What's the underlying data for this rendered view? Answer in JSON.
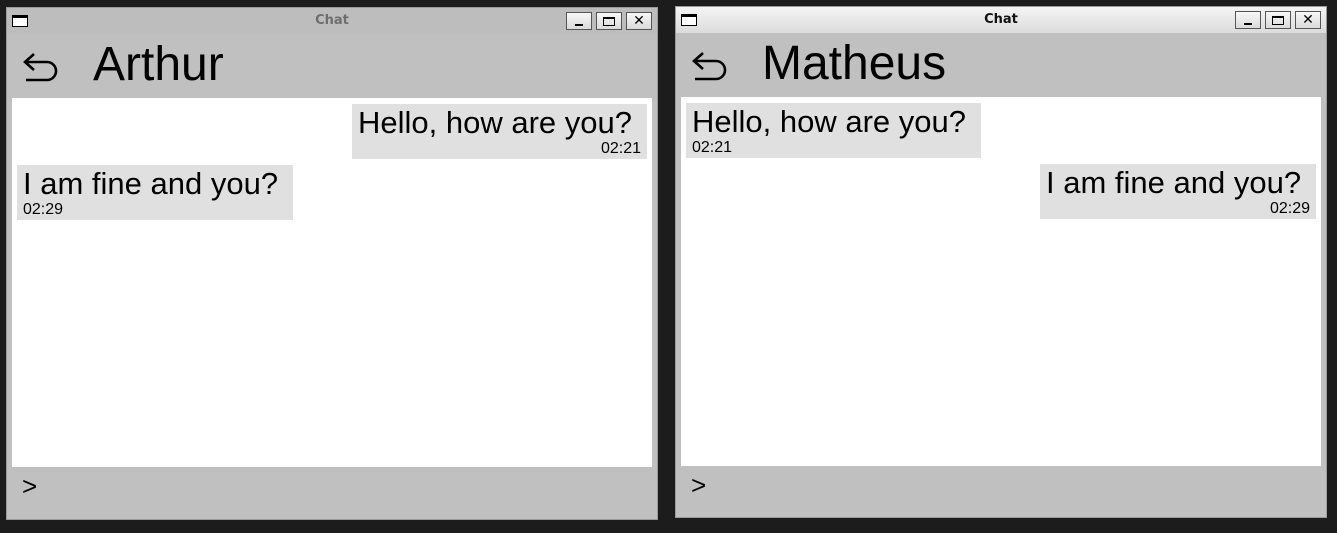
{
  "windows": [
    {
      "title": "Chat",
      "active": false,
      "contact_name": "Arthur",
      "send_symbol": ">",
      "messages": [
        {
          "text": "Hello, how are you?",
          "time": "02:21",
          "side": "right"
        },
        {
          "text": "I am fine and you?",
          "time": "02:29",
          "side": "left"
        }
      ]
    },
    {
      "title": "Chat",
      "active": true,
      "contact_name": "Matheus",
      "send_symbol": ">",
      "messages": [
        {
          "text": "Hello, how are you?",
          "time": "02:21",
          "side": "left"
        },
        {
          "text": "I am fine and you?",
          "time": "02:29",
          "side": "right"
        }
      ]
    }
  ],
  "icons": {
    "app": "window-app-icon",
    "minimize": "minimize-icon",
    "maximize": "maximize-icon",
    "close": "close-icon",
    "back": "back-arrow-icon"
  },
  "colors": {
    "desktop_background": "#1c1c1c",
    "window_chrome": "#c0c0c0",
    "chat_background": "#ffffff",
    "bubble_background": "#e0e0e0"
  }
}
